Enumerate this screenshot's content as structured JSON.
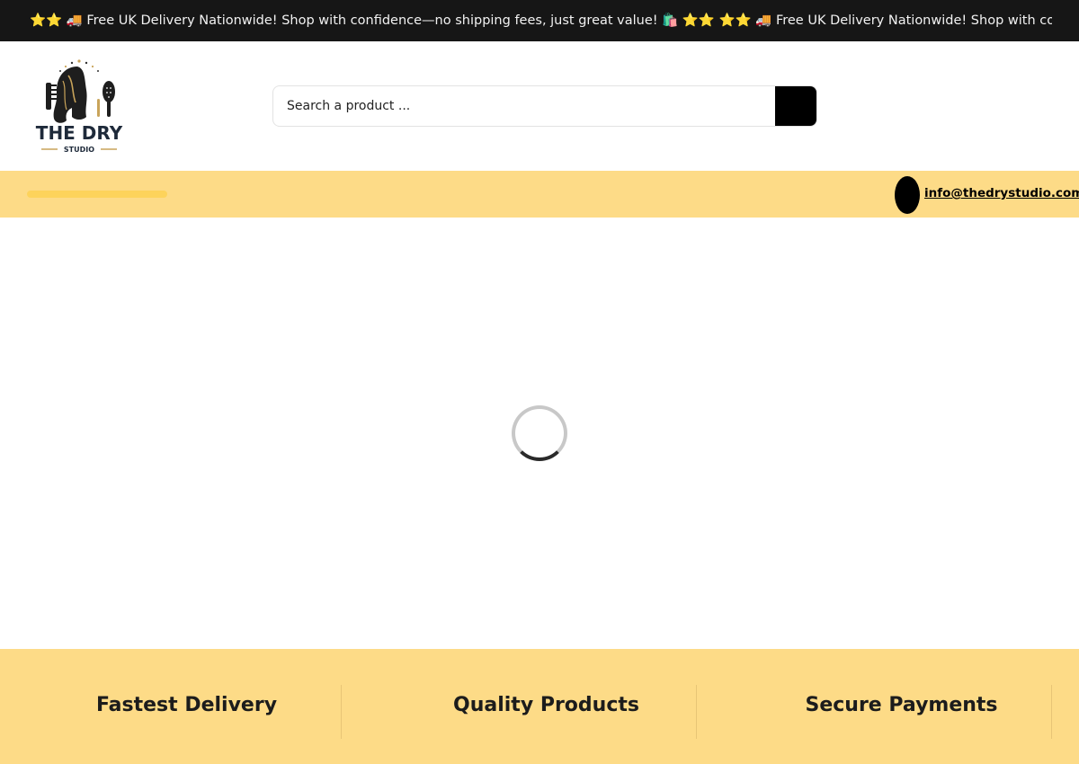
{
  "announcement": {
    "text": "⭐⭐  🚚 Free UK Delivery Nationwide! Shop with confidence—no shipping fees, just great value! 🛍️ ⭐⭐  ⭐⭐  🚚 Free UK Delivery Nationwide! Shop with confidence—no shipping fees, just great value! 🛍️ ⭐⭐"
  },
  "header": {
    "logo_text": "THE DRY",
    "logo_subtext": "STUDIO",
    "search": {
      "placeholder": "Search a product ..."
    }
  },
  "contact": {
    "email": "info@thedrystudio.com"
  },
  "features": [
    {
      "title": "Fastest Delivery"
    },
    {
      "title": "Quality Products"
    },
    {
      "title": "Secure Payments"
    }
  ],
  "colors": {
    "topbar_bg": "#161616",
    "accent_yellow": "#fddb87",
    "nav_placeholder": "#fdd35b",
    "button_black": "#000000"
  }
}
